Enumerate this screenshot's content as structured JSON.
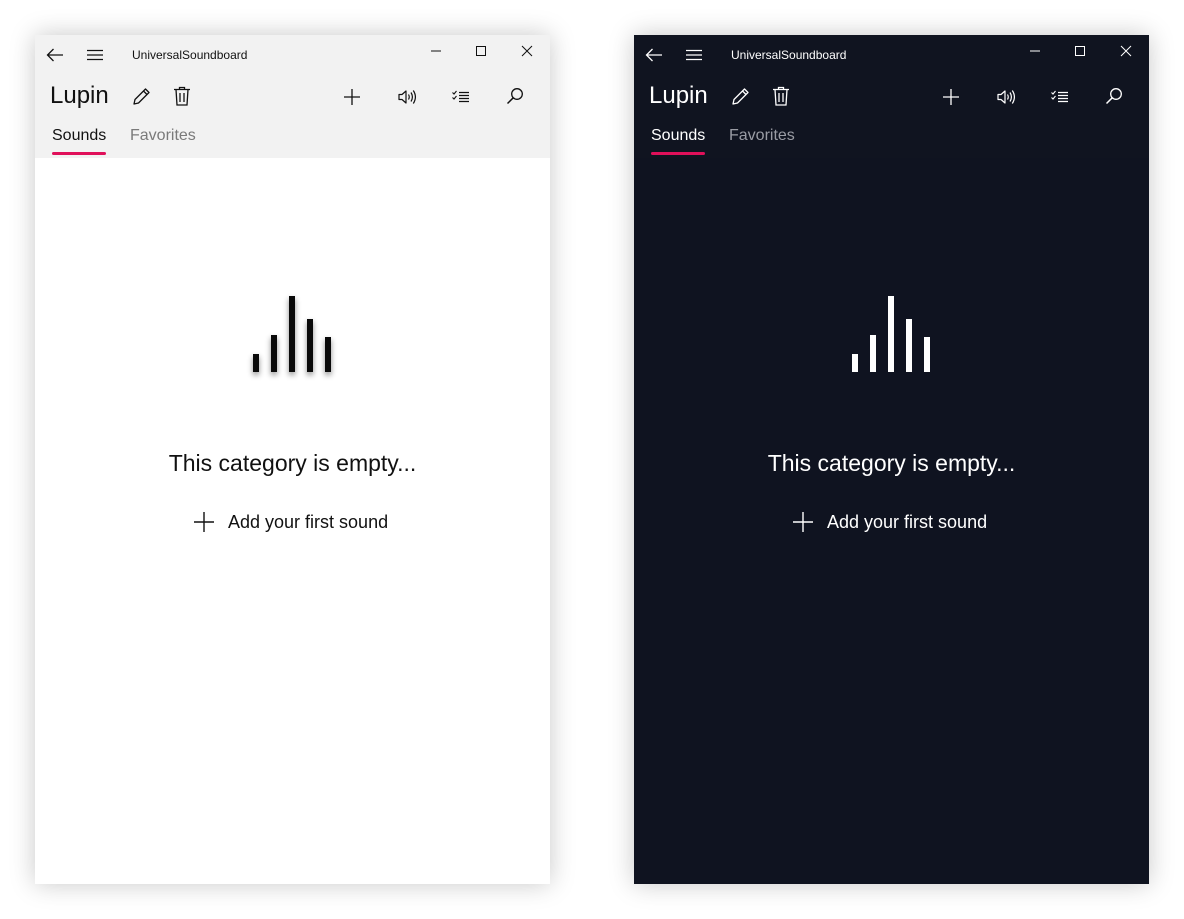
{
  "app_title": "UniversalSoundboard",
  "category_title": "Lupin",
  "tabs": [
    {
      "label": "Sounds",
      "selected": true
    },
    {
      "label": "Favorites",
      "selected": false
    }
  ],
  "empty_message": "This category is empty...",
  "add_first_sound_label": "Add your first sound",
  "toolbar_icons": [
    "back-arrow-icon",
    "hamburger-menu-icon",
    "minimize-icon",
    "maximize-icon",
    "close-icon",
    "edit-pencil-icon",
    "delete-trash-icon",
    "add-plus-icon",
    "volume-icon",
    "select-checklist-icon",
    "search-icon"
  ],
  "illustration_icon": "sound-bars-icon",
  "themes": {
    "light": {
      "background": "#ffffff",
      "header_background": "#f2f2f2",
      "foreground": "#111111",
      "muted_text": "#7a7a7a"
    },
    "dark": {
      "background": "#0f1320",
      "header_background": "#101420",
      "foreground": "#ffffff",
      "muted_text": "#9a9ca4"
    }
  },
  "accent_color": "#e0105a"
}
